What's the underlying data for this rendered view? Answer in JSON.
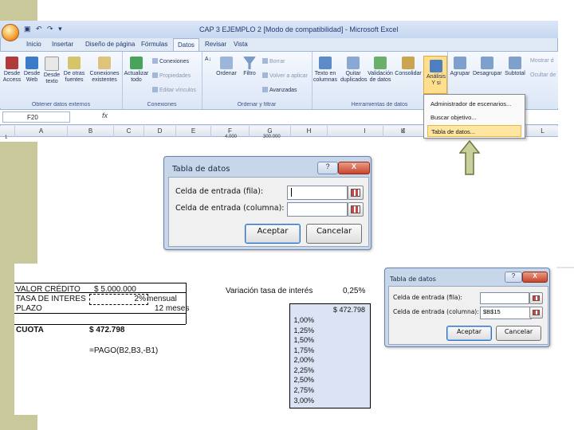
{
  "excel": {
    "title": "CAP 3 EJEMPLO 2 [Modo de compatibilidad] - Microsoft Excel",
    "tabs": [
      "Inicio",
      "Insertar",
      "Diseño de página",
      "Fórmulas",
      "Datos",
      "Revisar",
      "Vista"
    ],
    "active_tab": "Datos",
    "groups": [
      {
        "label": "Obtener datos externos",
        "buttons": [
          "Desde Access",
          "Desde Web",
          "Desde texto",
          "De otras fuentes",
          "Conexiones existentes"
        ]
      },
      {
        "label": "Conexiones",
        "buttons": [
          "Actualizar todo",
          "Conexiones",
          "Propiedades",
          "Editar vínculos"
        ]
      },
      {
        "label": "Ordenar y filtrar",
        "buttons": [
          "Ordenar",
          "Filtro",
          "Borrar",
          "Volver a aplicar",
          "Avanzadas"
        ]
      },
      {
        "label": "Herramientas de datos",
        "buttons": [
          "Texto en columnas",
          "Quitar duplicados",
          "Validación de datos",
          "Consolidar",
          "Análisis Y si"
        ]
      },
      {
        "label": "Esquema",
        "buttons": [
          "Agrupar",
          "Desagrupar",
          "Subtotal",
          "Mostrar d",
          "Ocultar de"
        ]
      }
    ],
    "name_box": "F20",
    "fx": "fx",
    "columns": [
      "A",
      "B",
      "C",
      "D",
      "E",
      "F",
      "G",
      "H",
      "I",
      "J",
      "K",
      "L"
    ],
    "row1_num": "1",
    "row1_values": [
      "4.000",
      "300.000"
    ],
    "whatif_menu": [
      "Administrador de escenarios...",
      "Buscar objetivo...",
      "Tabla de datos..."
    ]
  },
  "dialog1": {
    "title": "Tabla de datos",
    "help": "?",
    "close": "X",
    "row_label": "Celda de entrada (fila):",
    "col_label": "Celda de entrada (columna):",
    "row_value": "",
    "col_value": "",
    "ok": "Aceptar",
    "cancel": "Cancelar"
  },
  "dialog2": {
    "title": "Tabla de datos",
    "help": "?",
    "close": "X",
    "row_label": "Celda de entrada (fila):",
    "col_label": "Celda de entrada (columna):",
    "row_value": "",
    "col_value": "$B$15",
    "ok": "Aceptar",
    "cancel": "Cancelar"
  },
  "sheet": {
    "valor_label": "VALOR CRÉDITO",
    "valor_value": "$ 5.000.000",
    "tasa_label": "TASA DE INTERES",
    "tasa_value": "2%",
    "tasa_unit": "mensual",
    "plazo_label": "PLAZO",
    "plazo_value": "12 meses",
    "cuota_label": "CUOTA",
    "cuota_value": "$ 472.798",
    "formula": "=PAGO(B2,B3,-B1)",
    "variacion_label": "Variación tasa de interés",
    "variacion_value": "0,25%",
    "table_head": "$ 472.798",
    "rates": [
      "1,00%",
      "1,25%",
      "1,50%",
      "1,75%",
      "2,00%",
      "2,25%",
      "2,50%",
      "2,75%",
      "3,00%"
    ]
  }
}
